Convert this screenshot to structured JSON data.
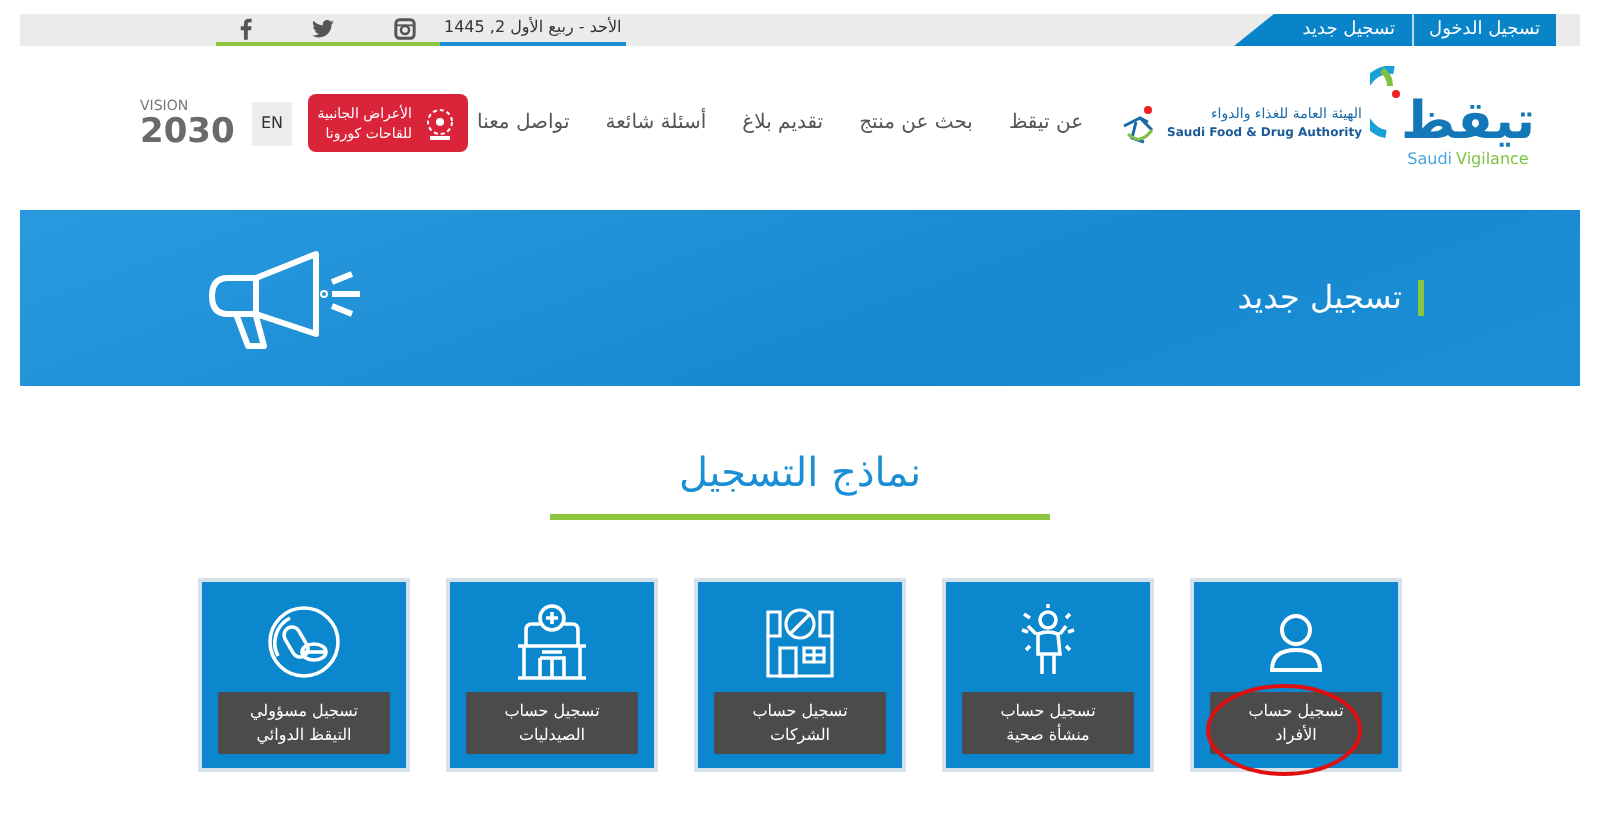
{
  "top_bar": {
    "account_links": [
      {
        "label": "تسجيل الدخول"
      },
      {
        "label": "تسجيل جديد"
      }
    ],
    "date": "الأحد - ربيع الأول 2, 1445",
    "social": [
      {
        "kind": "instagram"
      },
      {
        "kind": "twitter"
      },
      {
        "kind": "facebook"
      }
    ]
  },
  "header": {
    "logo": {
      "name": "تيقظ",
      "sub_left": "Saudi",
      "sub_right": "Vigilance"
    },
    "sfda_logo": {
      "arabic": "الهيئة العامة للغذاء والدواء",
      "english": "Saudi Food & Drug Authority"
    },
    "nav": [
      {
        "label": "عن تيقظ"
      },
      {
        "label": "بحث عن منتج"
      },
      {
        "label": "تقديم بلاغ"
      },
      {
        "label": "أسئلة شائعة"
      },
      {
        "label": "تواصل معنا"
      }
    ],
    "covid_badge": {
      "line_1": "الأعراض الجانبية",
      "line_2": "للقاحات كورونا"
    },
    "language": "EN",
    "vision_logo": {
      "word": "VISION",
      "year": "2030"
    }
  },
  "banner": {
    "title": "تسجيل جديد"
  },
  "section": {
    "title": "نماذج التسجيل",
    "cards": [
      {
        "kind": "person",
        "label": "تسجيل حساب\nالأفراد",
        "circled": true
      },
      {
        "kind": "facility",
        "label": "تسجيل حساب\nمنشأة صحية",
        "circled": false
      },
      {
        "kind": "company",
        "label": "تسجيل حساب\nالشركات",
        "circled": false
      },
      {
        "kind": "pharmacy",
        "label": "تسجيل حساب\nالصيدليات",
        "circled": false
      },
      {
        "kind": "pills",
        "label": "تسجيل مسؤولي\nالتيقظ الدوائي",
        "circled": false
      }
    ]
  }
}
